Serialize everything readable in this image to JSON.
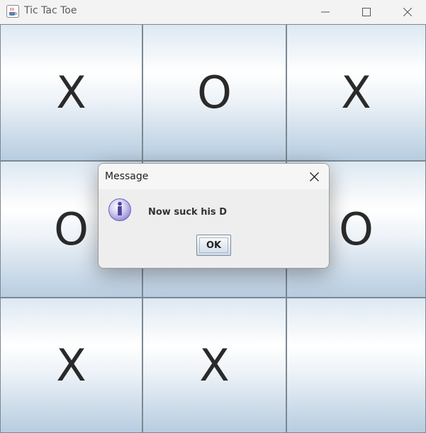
{
  "window": {
    "title": "Tic Tac Toe",
    "icon": "java-cup-icon"
  },
  "board": {
    "cells": [
      {
        "row": 1,
        "col": 1,
        "mark": "X"
      },
      {
        "row": 1,
        "col": 2,
        "mark": "O"
      },
      {
        "row": 1,
        "col": 3,
        "mark": "X"
      },
      {
        "row": 2,
        "col": 1,
        "mark": "O"
      },
      {
        "row": 2,
        "col": 2,
        "mark": ""
      },
      {
        "row": 2,
        "col": 3,
        "mark": "O"
      },
      {
        "row": 3,
        "col": 1,
        "mark": "X"
      },
      {
        "row": 3,
        "col": 2,
        "mark": "X"
      },
      {
        "row": 3,
        "col": 3,
        "mark": ""
      }
    ]
  },
  "dialog": {
    "title": "Message",
    "message": "Now suck his D",
    "icon": "info-icon",
    "ok_label": "OK"
  },
  "colors": {
    "cell_top": "#dde8f2",
    "cell_bottom": "#b8cde0",
    "grid_line": "#6d7b87",
    "mark": "#2a2a2a"
  }
}
